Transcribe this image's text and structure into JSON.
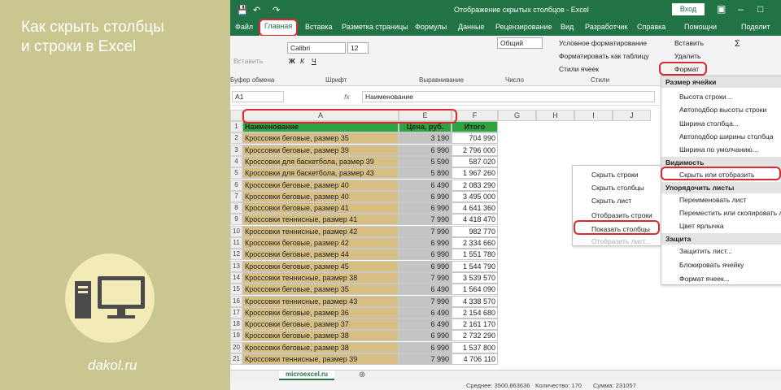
{
  "promo": {
    "title_line1": "Как скрыть столбцы",
    "title_line2": "и строки в Excel",
    "site": "dakol.ru"
  },
  "titlebar": {
    "title": "Отображение скрытых столбцов  -  Excel",
    "signin": "Вход"
  },
  "tabs": [
    "Файл",
    "Главная",
    "Вставка",
    "Разметка страницы",
    "Формулы",
    "Данные",
    "Рецензирование",
    "Вид",
    "Разработчик",
    "Справка",
    "Помощни",
    "Поделит"
  ],
  "ribbon": {
    "paste": "Вставить",
    "clipboard": "Буфер обмена",
    "font_name": "Calibri",
    "font_size": "12",
    "font_group": "Шрифт",
    "align_group": "Выравнивание",
    "number_format": "Общий",
    "number_group": "Число",
    "cond_format": "Условное форматирование",
    "format_table": "Форматировать как таблицу",
    "cell_styles": "Стили ячеек",
    "styles_group": "Стили",
    "insert": "Вставить",
    "delete": "Удалить",
    "format": "Формат"
  },
  "formula_bar": {
    "name_box": "A1",
    "fx": "fx",
    "value": "Наименование"
  },
  "columns": [
    "A",
    "E",
    "F",
    "G",
    "H",
    "I",
    "J"
  ],
  "rows": [
    [
      "Наименование",
      "Цена, руб.",
      "Итого"
    ],
    [
      "Кроссовки беговые, размер 35",
      "3 190",
      "704 990"
    ],
    [
      "Кроссовки беговые, размер 39",
      "6 990",
      "2 796 000"
    ],
    [
      "Кроссовки для баскетбола, размер 39",
      "5 590",
      "587 020"
    ],
    [
      "Кроссовки для баскетбола, размер 43",
      "5 890",
      "1 967 260"
    ],
    [
      "Кроссовки беговые, размер 40",
      "6 490",
      "2 083 290"
    ],
    [
      "Кроссовки беговые, размер 40",
      "6 990",
      "3 495 000"
    ],
    [
      "Кроссовки беговые, размер 41",
      "6 990",
      "4 641 360"
    ],
    [
      "Кроссовки теннисные, размер 41",
      "7 990",
      "4 418 470"
    ],
    [
      "Кроссовки теннисные, размер 42",
      "7 990",
      "982 770"
    ],
    [
      "Кроссовки беговые, размер 42",
      "6 990",
      "2 334 660"
    ],
    [
      "Кроссовки беговые, размер 44",
      "6 990",
      "1 551 780"
    ],
    [
      "Кроссовки беговые, размер 45",
      "6 990",
      "1 544 790"
    ],
    [
      "Кроссовки теннисные, размер 38",
      "7 990",
      "3 539 570"
    ],
    [
      "Кроссовки беговые, размер 35",
      "6 490",
      "1 564 090"
    ],
    [
      "Кроссовки теннисные, размер 43",
      "7 990",
      "4 338 570"
    ],
    [
      "Кроссовки беговые, размер 36",
      "6 490",
      "2 154 680"
    ],
    [
      "Кроссовки беговые, размер 37",
      "6 490",
      "2 161 170"
    ],
    [
      "Кроссовки беговые, размер 38",
      "6 990",
      "2 732 290"
    ],
    [
      "Кроссовки беговые, размер 38",
      "6 990",
      "1 537 800"
    ],
    [
      "Кроссовки теннисные, размер 39",
      "7 990",
      "4 706 110"
    ]
  ],
  "sheet_tab": "microexcel.ru",
  "status": {
    "avg": "Среднее: 3500,863636",
    "count": "Количество: 170",
    "sum": "Сумма: 231057"
  },
  "submenu": [
    "Скрыть строки",
    "Скрыть столбцы",
    "Скрыть лист",
    "Отобразить строки",
    "Показать столбцы",
    "Отобразить лист..."
  ],
  "format_menu": {
    "sec_size": "Размер ячейки",
    "row_height": "Высота строки...",
    "autofit_row": "Автоподбор высоты строки",
    "col_width": "Ширина столбца...",
    "autofit_col": "Автоподбор ширины столбца",
    "default_width": "Ширина по умолчанию...",
    "sec_visibility": "Видимость",
    "hide_show": "Скрыть или отобразить",
    "sec_sheets": "Упорядочить листы",
    "rename": "Переименовать лист",
    "move_copy": "Переместить или скопировать лист...",
    "tab_color": "Цвет ярлычка",
    "sec_protect": "Защита",
    "protect_sheet": "Защитить лист...",
    "lock_cell": "Блокировать ячейку",
    "format_cells": "Формат ячеек..."
  }
}
